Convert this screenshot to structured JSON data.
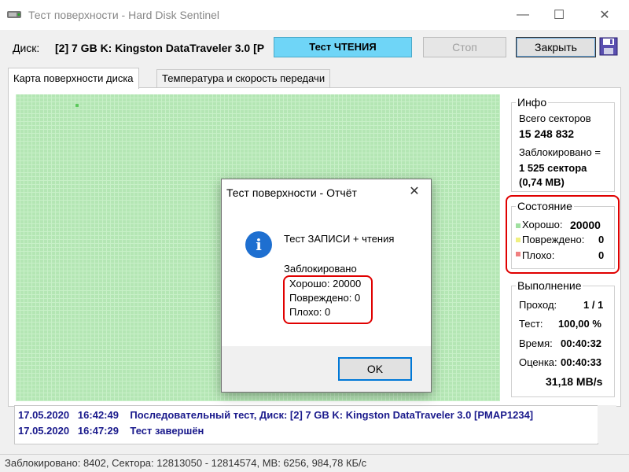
{
  "window": {
    "title": "Тест поверхности - Hard Disk Sentinel",
    "controls": {
      "minimize": "—",
      "maximize": "☐",
      "close": "✕"
    }
  },
  "toolbar": {
    "disk_label": "Диск:",
    "disk_value": "[2] 7 GB K: Kingston DataTraveler 3.0 [P",
    "read_test_label": "Тест ЧТЕНИЯ",
    "stop_label": "Стоп",
    "close_label": "Закрыть",
    "save_icon": "floppy-disk-icon",
    "accent_color": "#6fd5f7"
  },
  "tabs": [
    {
      "label": "Карта поверхности диска",
      "active": true
    },
    {
      "label": "Температура и скорость передачи",
      "active": false
    }
  ],
  "info": {
    "title": "Инфо",
    "total_sectors_label": "Всего секторов",
    "total_sectors_value": "15 248 832",
    "locked_label": "Заблокировано =",
    "locked_value": "1 525 сектора",
    "locked_size": "(0,74 MB)"
  },
  "state": {
    "title": "Состояние",
    "good_label": "Хорошо:",
    "good_value": "20000",
    "damaged_label": "Повреждено:",
    "damaged_value": "0",
    "bad_label": "Плохо:",
    "bad_value": "0",
    "colors": {
      "good": "#a0e0a0",
      "damaged": "#f0f080",
      "bad": "#f08080"
    }
  },
  "progress": {
    "title": "Выполнение",
    "pass_label": "Проход:",
    "pass_value": "1 / 1",
    "test_label": "Тест:",
    "test_value": "100,00 %",
    "time_label": "Время:",
    "time_value": "00:40:32",
    "estimate_label": "Оценка:",
    "estimate_value": "00:40:33",
    "speed_value": "31,18 MB/s"
  },
  "log": [
    {
      "date": "17.05.2020",
      "time": "16:42:49",
      "message": "Последовательный тест, Диск: [2] 7 GB K: Kingston DataTraveler 3.0 [PMAP1234]"
    },
    {
      "date": "17.05.2020",
      "time": "16:47:29",
      "message": "Тест завершён"
    }
  ],
  "statusbar": {
    "text": "Заблокировано: 8402, Сектора: 12813050 - 12814574, MB: 6256, 984,78 КБ/с"
  },
  "dialog": {
    "title": "Тест поверхности - Отчёт",
    "close": "✕",
    "icon": "info-icon",
    "heading": "Тест ЗАПИСИ + чтения",
    "locked_label": "Заблокировано",
    "good_line": "Хорошо: 20000",
    "damaged_line": "Повреждено: 0",
    "bad_line": "Плохо: 0",
    "ok_label": "OK"
  }
}
